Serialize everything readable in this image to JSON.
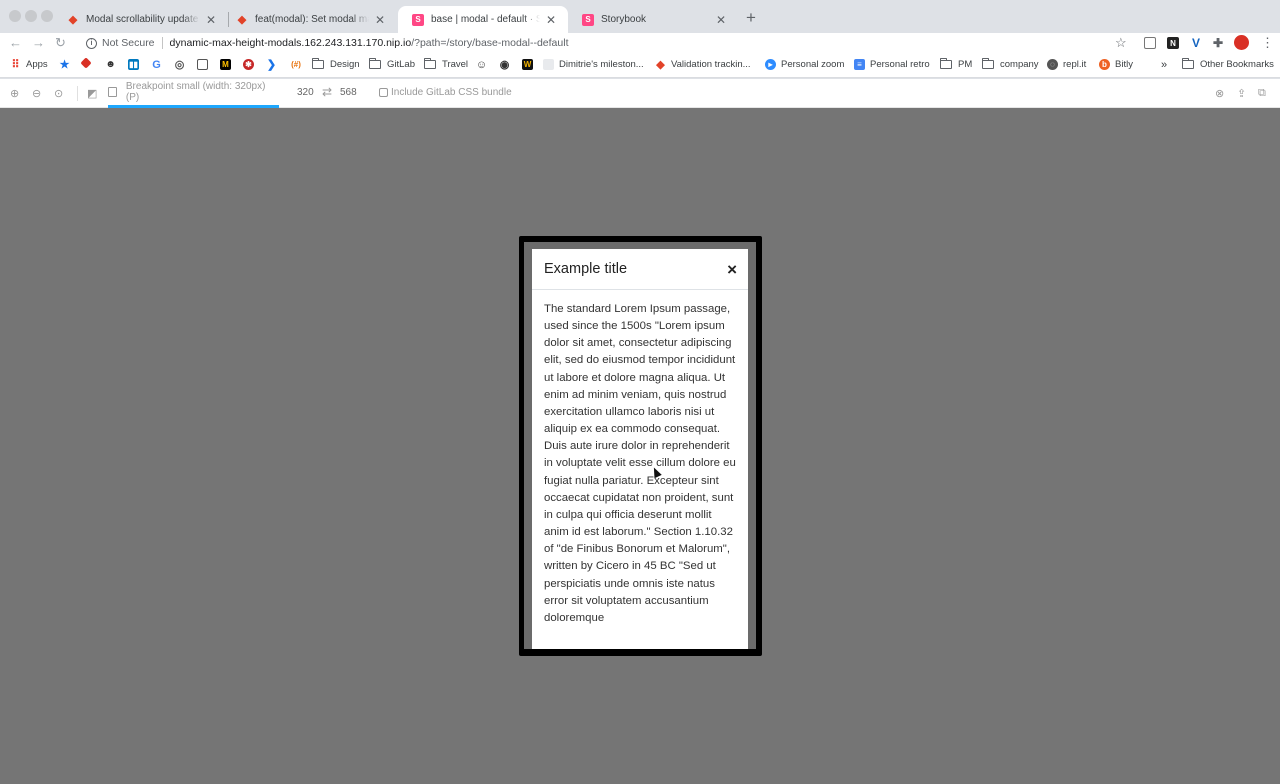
{
  "tabs": [
    {
      "title": "Modal scrollability update base",
      "favicon": "gitlab-icon"
    },
    {
      "title": "feat(modal): Set modal max he",
      "favicon": "gitlab-icon"
    },
    {
      "title": "base | modal - default · Storyb",
      "favicon": "storybook-icon",
      "active": true
    },
    {
      "title": "Storybook",
      "favicon": "storybook-icon"
    }
  ],
  "address": {
    "security": "Not Secure",
    "host": "dynamic-max-height-modals.162.243.131.170.nip.io",
    "path": "/?path=/story/base-modal--default"
  },
  "bookmarks": {
    "apps": "Apps",
    "design": "Design",
    "gitlab": "GitLab",
    "travel": "Travel",
    "milestone": "Dimitrie's mileston...",
    "validation": "Validation trackin...",
    "personal_zoom": "Personal zoom",
    "personal_retro": "Personal retro",
    "pm": "PM",
    "company": "company",
    "replit": "repl.it",
    "bitly": "Bitly",
    "more": "»",
    "other": "Other Bookmarks"
  },
  "storybook": {
    "breakpoint": "Breakpoint small (width: 320px) (P)",
    "width": "320",
    "height": "568",
    "css_bundle": "Include GitLab CSS bundle"
  },
  "modal": {
    "title": "Example title",
    "close": "×",
    "body": "The standard Lorem Ipsum passage, used since the 1500s \"Lorem ipsum dolor sit amet, consectetur adipiscing elit, sed do eiusmod tempor incididunt ut labore et dolore magna aliqua. Ut enim ad minim veniam, quis nostrud exercitation ullamco laboris nisi ut aliquip ex ea commodo consequat. Duis aute irure dolor in reprehenderit in voluptate velit esse cillum dolore eu fugiat nulla pariatur. Excepteur sint occaecat cupidatat non proident, sunt in culpa qui officia deserunt mollit anim id est laborum.\" Section 1.10.32 of \"de Finibus Bonorum et Malorum\", written by Cicero in 45 BC \"Sed ut perspiciatis unde omnis iste natus error sit voluptatem accusantium doloremque"
  },
  "colors": {
    "storybook_accent": "#1ea7fd",
    "storybook_pink": "#ff4785",
    "gitlab_orange": "#e24329",
    "preview_bg": "#757575"
  }
}
